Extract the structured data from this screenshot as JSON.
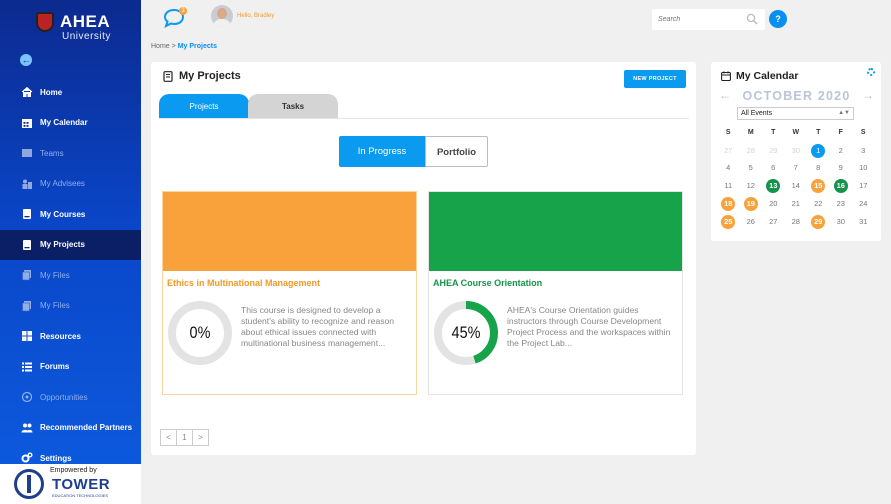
{
  "brand": {
    "name": "AHEA",
    "subtitle": "University"
  },
  "sidebar": {
    "items": [
      {
        "label": "Home",
        "icon": "home-icon",
        "state": "normal"
      },
      {
        "label": "My Calendar",
        "icon": "calendar-icon",
        "state": "normal"
      },
      {
        "label": "Teams",
        "icon": "teams-icon",
        "state": "dim"
      },
      {
        "label": "My Advisees",
        "icon": "advisees-icon",
        "state": "dim"
      },
      {
        "label": "My Courses",
        "icon": "book-icon",
        "state": "normal"
      },
      {
        "label": "My Projects",
        "icon": "book-icon",
        "state": "active"
      },
      {
        "label": "My Files",
        "icon": "files-icon",
        "state": "dim"
      },
      {
        "label": "My Files",
        "icon": "files-icon",
        "state": "dim"
      },
      {
        "label": "Resources",
        "icon": "grid-icon",
        "state": "normal"
      },
      {
        "label": "Forums",
        "icon": "list-icon",
        "state": "normal"
      },
      {
        "label": "Opportunities",
        "icon": "opportunities-icon",
        "state": "dim"
      },
      {
        "label": "Recommended Partners",
        "icon": "users-icon",
        "state": "normal"
      },
      {
        "label": "Settings",
        "icon": "gears-icon",
        "state": "normal"
      }
    ]
  },
  "powered": {
    "by": "Empowered by",
    "name": "TOWER",
    "tagline": "EDUCATION TECHNOLOGIES"
  },
  "topbar": {
    "chat_badge": "3",
    "greeting": "Hello, Bradley",
    "search_placeholder": "Search",
    "help_label": "?"
  },
  "breadcrumb": {
    "home": "Home",
    "separator": ">",
    "current": "My Projects"
  },
  "projects": {
    "title": "My Projects",
    "new_button": "NEW PROJECT",
    "tabs": [
      "Projects",
      "Tasks"
    ],
    "segments": [
      "In Progress",
      "Portfolio"
    ],
    "cards": [
      {
        "title": "Ethics in Multinational Management",
        "progress": 0,
        "progress_label": "0%",
        "description": "This course is designed to develop a student's ability to recognize and reason about ethical issues connected with multinational business management...",
        "banner_color": "#f9a23b",
        "progress_color": "#16934a"
      },
      {
        "title": "AHEA Course Orientation",
        "progress": 45,
        "progress_label": "45%",
        "description": "AHEA's Course Orientation guides instructors through Course Development Project Process and the workspaces within the Project Lab...",
        "banner_color": "#16a34a",
        "progress_color": "#16a34a"
      }
    ],
    "pager": [
      "<",
      "1",
      ">"
    ]
  },
  "calendar": {
    "title": "My Calendar",
    "month": "OCTOBER 2020",
    "prev": "←",
    "next": "→",
    "filter": "All Events",
    "weekdays": [
      "S",
      "M",
      "T",
      "W",
      "T",
      "F",
      "S"
    ],
    "weeks": [
      [
        {
          "d": "27",
          "t": "other"
        },
        {
          "d": "28",
          "t": "other"
        },
        {
          "d": "29",
          "t": "other"
        },
        {
          "d": "30",
          "t": "other"
        },
        {
          "d": "1",
          "t": "today"
        },
        {
          "d": "2",
          "t": ""
        },
        {
          "d": "3",
          "t": ""
        }
      ],
      [
        {
          "d": "4",
          "t": ""
        },
        {
          "d": "5",
          "t": ""
        },
        {
          "d": "6",
          "t": ""
        },
        {
          "d": "7",
          "t": ""
        },
        {
          "d": "8",
          "t": ""
        },
        {
          "d": "9",
          "t": ""
        },
        {
          "d": "10",
          "t": ""
        }
      ],
      [
        {
          "d": "11",
          "t": ""
        },
        {
          "d": "12",
          "t": ""
        },
        {
          "d": "13",
          "t": "green"
        },
        {
          "d": "14",
          "t": ""
        },
        {
          "d": "15",
          "t": "orange"
        },
        {
          "d": "16",
          "t": "green"
        },
        {
          "d": "17",
          "t": ""
        }
      ],
      [
        {
          "d": "18",
          "t": "orange"
        },
        {
          "d": "19",
          "t": "orange"
        },
        {
          "d": "20",
          "t": ""
        },
        {
          "d": "21",
          "t": ""
        },
        {
          "d": "22",
          "t": ""
        },
        {
          "d": "23",
          "t": ""
        },
        {
          "d": "24",
          "t": ""
        }
      ],
      [
        {
          "d": "25",
          "t": "orange"
        },
        {
          "d": "26",
          "t": ""
        },
        {
          "d": "27",
          "t": ""
        },
        {
          "d": "28",
          "t": ""
        },
        {
          "d": "29",
          "t": "orange"
        },
        {
          "d": "30",
          "t": ""
        },
        {
          "d": "31",
          "t": ""
        }
      ]
    ]
  },
  "colors": {
    "primary": "#0a9bf0",
    "sidebar": "#0c2a8f",
    "orange": "#f9a23b",
    "green": "#16934a"
  }
}
